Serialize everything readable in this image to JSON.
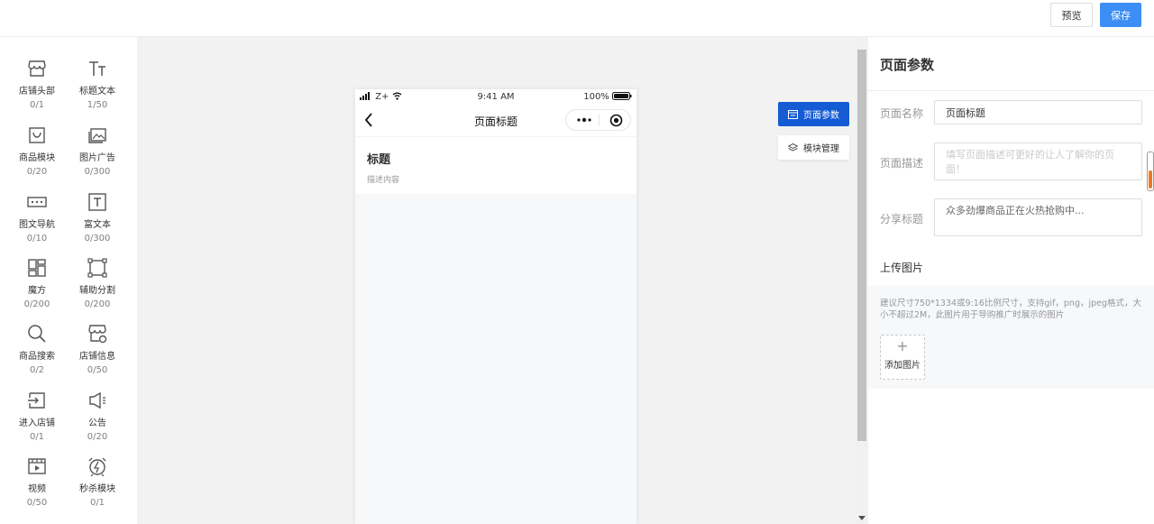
{
  "topbar": {
    "preview_label": "预览",
    "save_label": "保存"
  },
  "components": [
    {
      "name": "店铺头部",
      "count": "0/1",
      "icon": "store-header-icon"
    },
    {
      "name": "标题文本",
      "count": "1/50",
      "icon": "title-text-icon"
    },
    {
      "name": "商品模块",
      "count": "0/20",
      "icon": "goods-module-icon"
    },
    {
      "name": "图片广告",
      "count": "0/300",
      "icon": "image-ad-icon"
    },
    {
      "name": "图文导航",
      "count": "0/10",
      "icon": "image-nav-icon"
    },
    {
      "name": "富文本",
      "count": "0/300",
      "icon": "rich-text-icon"
    },
    {
      "name": "魔方",
      "count": "0/200",
      "icon": "cube-icon"
    },
    {
      "name": "辅助分割",
      "count": "0/200",
      "icon": "divider-icon"
    },
    {
      "name": "商品搜索",
      "count": "0/2",
      "icon": "search-icon"
    },
    {
      "name": "店铺信息",
      "count": "0/50",
      "icon": "store-info-icon"
    },
    {
      "name": "进入店铺",
      "count": "0/1",
      "icon": "enter-store-icon"
    },
    {
      "name": "公告",
      "count": "0/20",
      "icon": "notice-icon"
    },
    {
      "name": "视频",
      "count": "0/50",
      "icon": "video-icon"
    },
    {
      "name": "秒杀模块",
      "count": "0/1",
      "icon": "flash-sale-icon"
    }
  ],
  "phone": {
    "carrier": "Z+",
    "time": "9:41 AM",
    "battery": "100%",
    "nav_title": "页面标题",
    "block_title": "标题",
    "block_desc": "描述内容"
  },
  "side_buttons": {
    "page_params": "页面参数",
    "module_manage": "模块管理"
  },
  "panel": {
    "title": "页面参数",
    "name_label": "页面名称",
    "name_value": "页面标题",
    "desc_label": "页面描述",
    "desc_placeholder": "填写页面描述可更好的让人了解你的页面！",
    "share_label": "分享标题",
    "share_placeholder": "众多劲爆商品正在火热抢购中...",
    "upload_title": "上传图片",
    "upload_tip": "建议尺寸750*1334或9:16比例尺寸，支持gif，png，jpeg格式，大小不超过2M，此图片用于导购推广时展示的图片",
    "add_image": "添加图片"
  },
  "colors": {
    "primary": "#155bd4",
    "save": "#3c8ef5"
  }
}
